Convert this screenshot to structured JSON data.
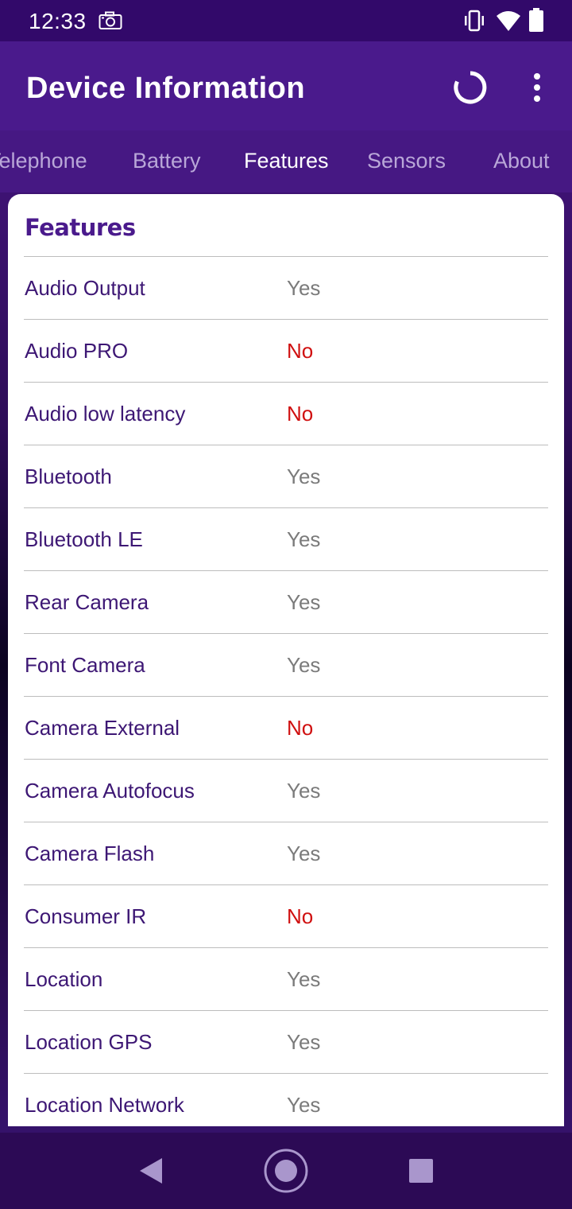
{
  "status_bar": {
    "time": "12:33",
    "icons": [
      "camera-icon",
      "vibrate-icon",
      "wifi-icon",
      "battery-icon"
    ]
  },
  "app_bar": {
    "title": "Device Information",
    "actions": [
      "refresh-icon",
      "more-vert-icon"
    ]
  },
  "tabs": [
    {
      "label": "Telephone",
      "active": false
    },
    {
      "label": "Battery",
      "active": false
    },
    {
      "label": "Features",
      "active": true
    },
    {
      "label": "Sensors",
      "active": false
    },
    {
      "label": "About",
      "active": false
    }
  ],
  "card": {
    "title": "Features",
    "rows": [
      {
        "label": "Audio Output",
        "value": "Yes"
      },
      {
        "label": "Audio PRO",
        "value": "No"
      },
      {
        "label": "Audio low latency",
        "value": "No"
      },
      {
        "label": "Bluetooth",
        "value": "Yes"
      },
      {
        "label": "Bluetooth LE",
        "value": "Yes"
      },
      {
        "label": "Rear Camera",
        "value": "Yes"
      },
      {
        "label": "Font Camera",
        "value": "Yes"
      },
      {
        "label": "Camera External",
        "value": "No"
      },
      {
        "label": "Camera Autofocus",
        "value": "Yes"
      },
      {
        "label": "Camera Flash",
        "value": "Yes"
      },
      {
        "label": "Consumer IR",
        "value": "No"
      },
      {
        "label": "Location",
        "value": "Yes"
      },
      {
        "label": "Location GPS",
        "value": "Yes"
      },
      {
        "label": "Location Network",
        "value": "Yes"
      }
    ]
  },
  "colors": {
    "primary": "#4a1a8c",
    "status_bar": "#32096a",
    "label_text": "#3d1774",
    "yes_text": "#7b7b7b",
    "no_text": "#d01010"
  },
  "nav_bar": {
    "buttons": [
      "back-icon",
      "home-icon",
      "recents-icon"
    ]
  }
}
